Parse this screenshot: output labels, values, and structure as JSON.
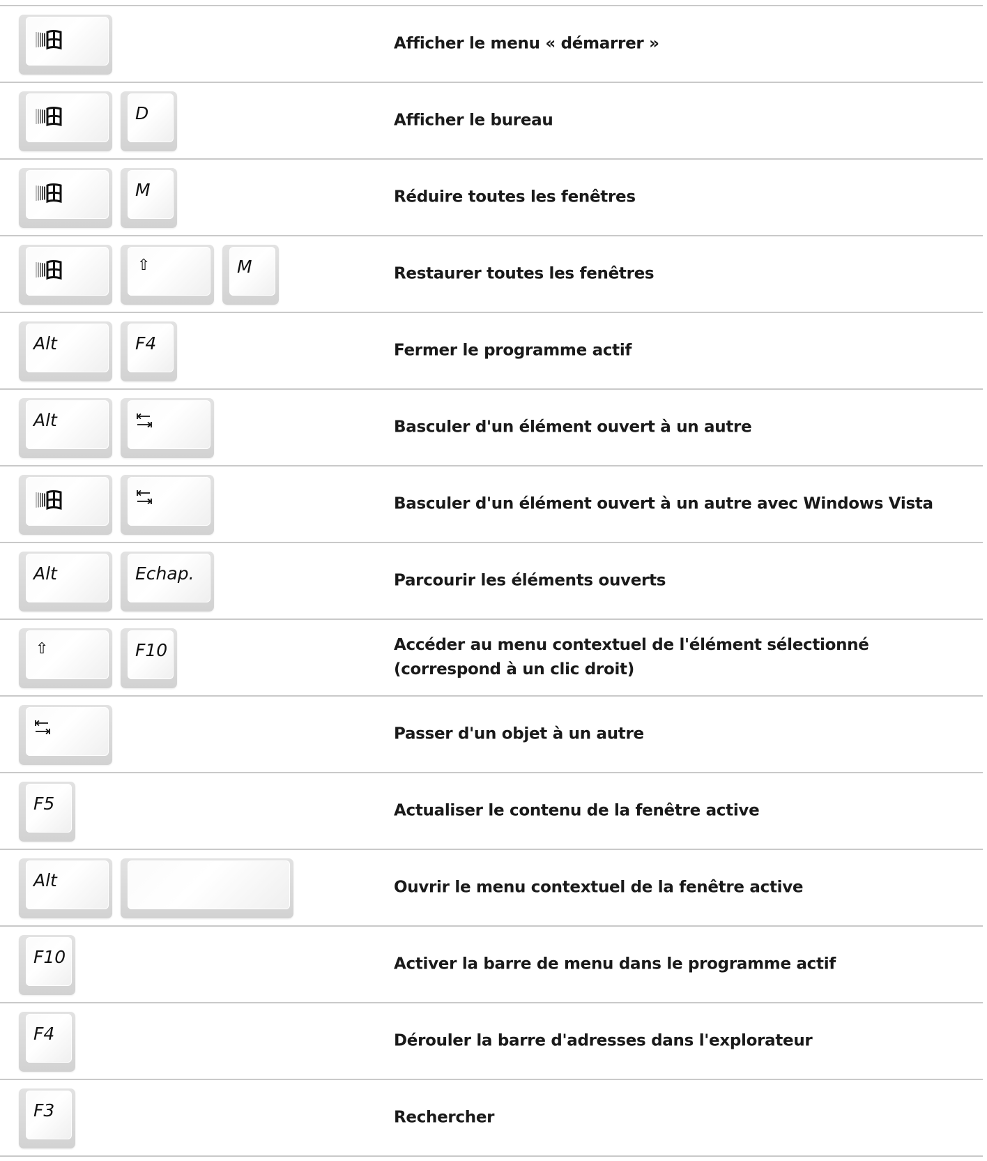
{
  "shortcuts": [
    {
      "keys": [
        {
          "type": "win"
        }
      ],
      "description": [
        "Afficher le menu « démarrer »"
      ]
    },
    {
      "keys": [
        {
          "type": "win"
        },
        {
          "type": "text",
          "label": "D"
        }
      ],
      "description": [
        "Afficher le bureau"
      ]
    },
    {
      "keys": [
        {
          "type": "win"
        },
        {
          "type": "text",
          "label": "M"
        }
      ],
      "description": [
        "Réduire toutes les fenêtres"
      ]
    },
    {
      "keys": [
        {
          "type": "win"
        },
        {
          "type": "glyph",
          "label": "⇧"
        },
        {
          "type": "text",
          "label": "M"
        }
      ],
      "description": [
        "Restaurer toutes les fenêtres"
      ]
    },
    {
      "keys": [
        {
          "type": "text",
          "label": "Alt"
        },
        {
          "type": "text",
          "label": "F4"
        }
      ],
      "description": [
        "Fermer le programme actif"
      ]
    },
    {
      "keys": [
        {
          "type": "text",
          "label": "Alt"
        },
        {
          "type": "tab"
        }
      ],
      "description": [
        "Basculer d'un élément ouvert à un autre"
      ]
    },
    {
      "keys": [
        {
          "type": "win"
        },
        {
          "type": "tab"
        }
      ],
      "description": [
        "Basculer d'un élément ouvert à un autre avec Windows Vista"
      ]
    },
    {
      "keys": [
        {
          "type": "text",
          "label": "Alt"
        },
        {
          "type": "text",
          "label": "Echap."
        }
      ],
      "description": [
        "Parcourir les éléments ouverts"
      ]
    },
    {
      "keys": [
        {
          "type": "glyph",
          "label": "⇧"
        },
        {
          "type": "text",
          "label": "F10"
        }
      ],
      "description": [
        "Accéder au menu contextuel de l'élément sélectionné",
        "(correspond à un clic droit)"
      ]
    },
    {
      "keys": [
        {
          "type": "tab"
        }
      ],
      "description": [
        "Passer d'un objet à un autre"
      ]
    },
    {
      "keys": [
        {
          "type": "text",
          "label": "F5"
        }
      ],
      "description": [
        "Actualiser le contenu de la fenêtre active"
      ]
    },
    {
      "keys": [
        {
          "type": "text",
          "label": "Alt"
        },
        {
          "type": "space"
        }
      ],
      "description": [
        "Ouvrir le menu contextuel de la fenêtre active"
      ]
    },
    {
      "keys": [
        {
          "type": "text",
          "label": "F10"
        }
      ],
      "description": [
        "Activer la barre de menu dans le programme actif"
      ]
    },
    {
      "keys": [
        {
          "type": "text",
          "label": "F4"
        }
      ],
      "description": [
        "Dérouler la barre d'adresses dans l'explorateur"
      ]
    },
    {
      "keys": [
        {
          "type": "text",
          "label": "F3"
        }
      ],
      "description": [
        "Rechercher"
      ]
    }
  ]
}
